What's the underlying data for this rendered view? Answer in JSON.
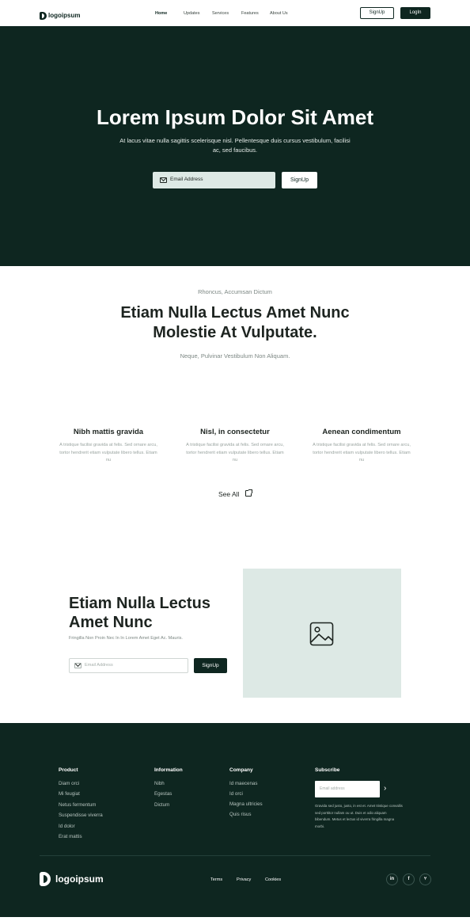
{
  "nav": {
    "logo_text": "logoipsum",
    "links": [
      "Home",
      "Updates",
      "Services",
      "Features",
      "About Us"
    ],
    "signup_label": "SignUp",
    "login_label": "LogIn"
  },
  "hero": {
    "title": "Lorem Ipsum Dolor Sit Amet",
    "subtitle": "At lacus vitae nulla sagittis scelerisque nisl. Pellentesque duis cursus vestibulum, facilisi ac, sed faucibus.",
    "email_placeholder": "Email Address",
    "signup_label": "SignUp"
  },
  "features": {
    "eyebrow": "Rhoncus, Accumsan Dictum",
    "title_line1": "Etiam Nulla Lectus Amet Nunc",
    "title_line2": "Molestie At Vulputate.",
    "subtitle": "Neque, Pulvinar Vestibulum Non Aliquam.",
    "items": [
      {
        "title": "Nibh mattis gravida",
        "body": "A tristique facilisi gravida at felis. Sed ornare arcu, tortor hendrerit etiam vulputate libero tellus. Etiam nu"
      },
      {
        "title": "Nisl, in consectetur",
        "body": "A tristique facilisi gravida at felis. Sed ornare arcu, tortor hendrerit etiam vulputate libero tellus. Etiam nu"
      },
      {
        "title": "Aenean condimentum",
        "body": "A tristique facilisi gravida at felis. Sed ornare arcu, tortor hendrerit etiam vulputate libero tellus. Etiam nu"
      }
    ],
    "see_all_label": "See All"
  },
  "cta": {
    "title_line1": "Etiam Nulla Lectus",
    "title_line2": "Amet Nunc",
    "subtitle": "Fringilla Non Proin Nec In In Lorem Amet Eget Ac. Mauris.",
    "email_placeholder": "Email Address",
    "signup_label": "SignUp"
  },
  "footer": {
    "columns": [
      {
        "heading": "Product",
        "links": [
          "Diam orci",
          "Mi feugiat",
          "Netus fermentum",
          "Suspendisse viverra",
          "Id dolor",
          "Erat mattis"
        ]
      },
      {
        "heading": "Information",
        "links": [
          "Nibh",
          "Egestas",
          "Dictum"
        ]
      },
      {
        "heading": "Company",
        "links": [
          "Id maecenas",
          "Id orci",
          "Magna ultricies",
          "Quis risus"
        ]
      }
    ],
    "subscribe": {
      "heading": "Subscribe",
      "email_placeholder": "Email address",
      "arrow": "›",
      "note": "Gravida sed justo, justo, in est et. Amet tristique convallis sed porttitor nullam ou ut. Duis et odio aliquam bibendum. Metus et lectus id viverra fringilla magna morbi."
    },
    "logo_text": "logoipsum",
    "legal_links": [
      "Terms",
      "Privacy",
      "Cookies"
    ],
    "social": [
      "in",
      "f",
      "⑂"
    ]
  },
  "colors": {
    "primary_dark": "#0e2620",
    "accent_light": "#dde9e5"
  },
  "icons": [
    "logo-icon",
    "mail-icon",
    "external-link-icon",
    "image-placeholder-icon",
    "arrow-right-icon",
    "linkedin-icon",
    "facebook-icon",
    "other-social-icon"
  ]
}
